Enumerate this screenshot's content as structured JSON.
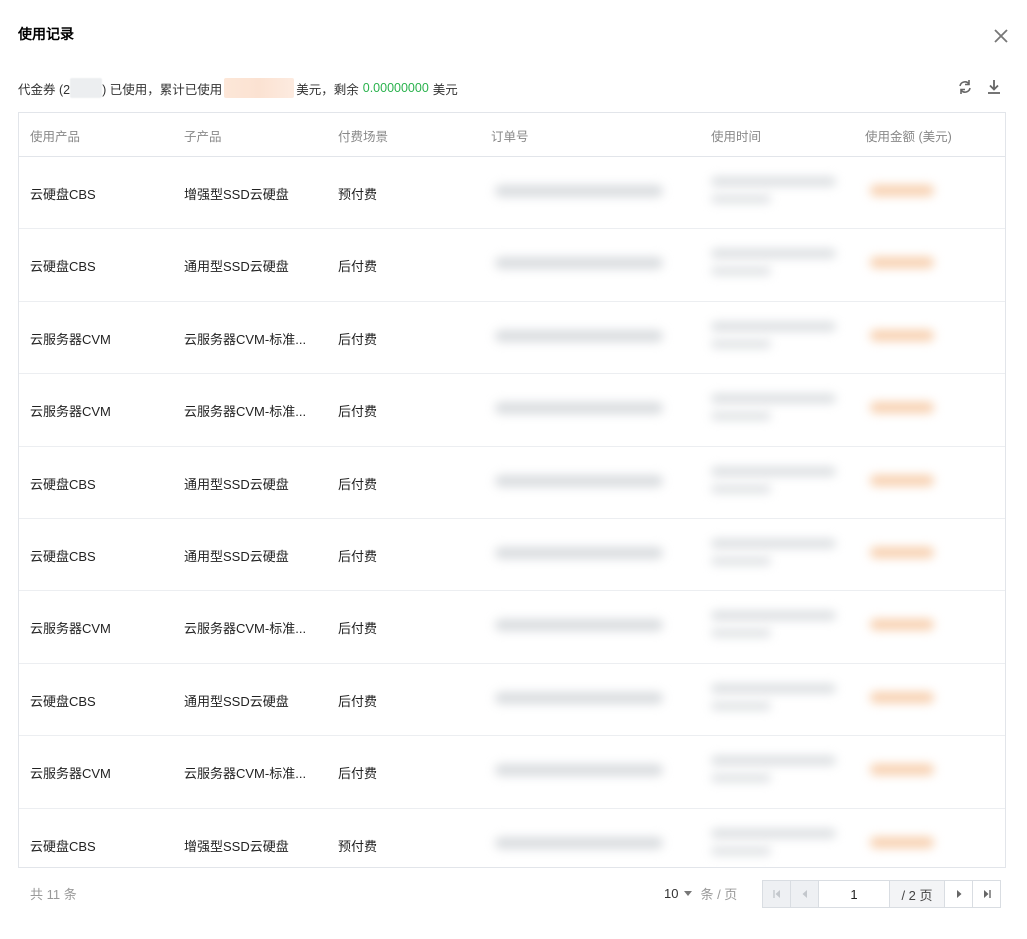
{
  "dialog": {
    "title": "使用记录"
  },
  "summary": {
    "prefix": "代金券 (2",
    "used_text": ") 已使用，累计已使用",
    "unit1": "美元，剩余",
    "remaining": "0.00000000",
    "unit2": "美元"
  },
  "table": {
    "columns": [
      "使用产品",
      "子产品",
      "付费场景",
      "订单号",
      "使用时间",
      "使用金额 (美元)"
    ],
    "rows": [
      {
        "product": "云硬盘CBS",
        "subproduct": "增强型SSD云硬盘",
        "scene": "预付费"
      },
      {
        "product": "云硬盘CBS",
        "subproduct": "通用型SSD云硬盘",
        "scene": "后付费"
      },
      {
        "product": "云服务器CVM",
        "subproduct": "云服务器CVM-标准...",
        "scene": "后付费"
      },
      {
        "product": "云服务器CVM",
        "subproduct": "云服务器CVM-标准...",
        "scene": "后付费"
      },
      {
        "product": "云硬盘CBS",
        "subproduct": "通用型SSD云硬盘",
        "scene": "后付费"
      },
      {
        "product": "云硬盘CBS",
        "subproduct": "通用型SSD云硬盘",
        "scene": "后付费"
      },
      {
        "product": "云服务器CVM",
        "subproduct": "云服务器CVM-标准...",
        "scene": "后付费"
      },
      {
        "product": "云硬盘CBS",
        "subproduct": "通用型SSD云硬盘",
        "scene": "后付费"
      },
      {
        "product": "云服务器CVM",
        "subproduct": "云服务器CVM-标准...",
        "scene": "后付费"
      },
      {
        "product": "云硬盘CBS",
        "subproduct": "增强型SSD云硬盘",
        "scene": "预付费"
      }
    ]
  },
  "footer": {
    "total": "共 11 条",
    "page_size": "10",
    "page_size_unit": "条 / 页",
    "current_page": "1",
    "total_pages": "/ 2 页"
  },
  "icons": {
    "close": "close-icon",
    "refresh": "refresh-icon",
    "download": "download-icon"
  },
  "colors": {
    "remaining_green": "#2ab24d",
    "border": "#e2e5ea"
  }
}
